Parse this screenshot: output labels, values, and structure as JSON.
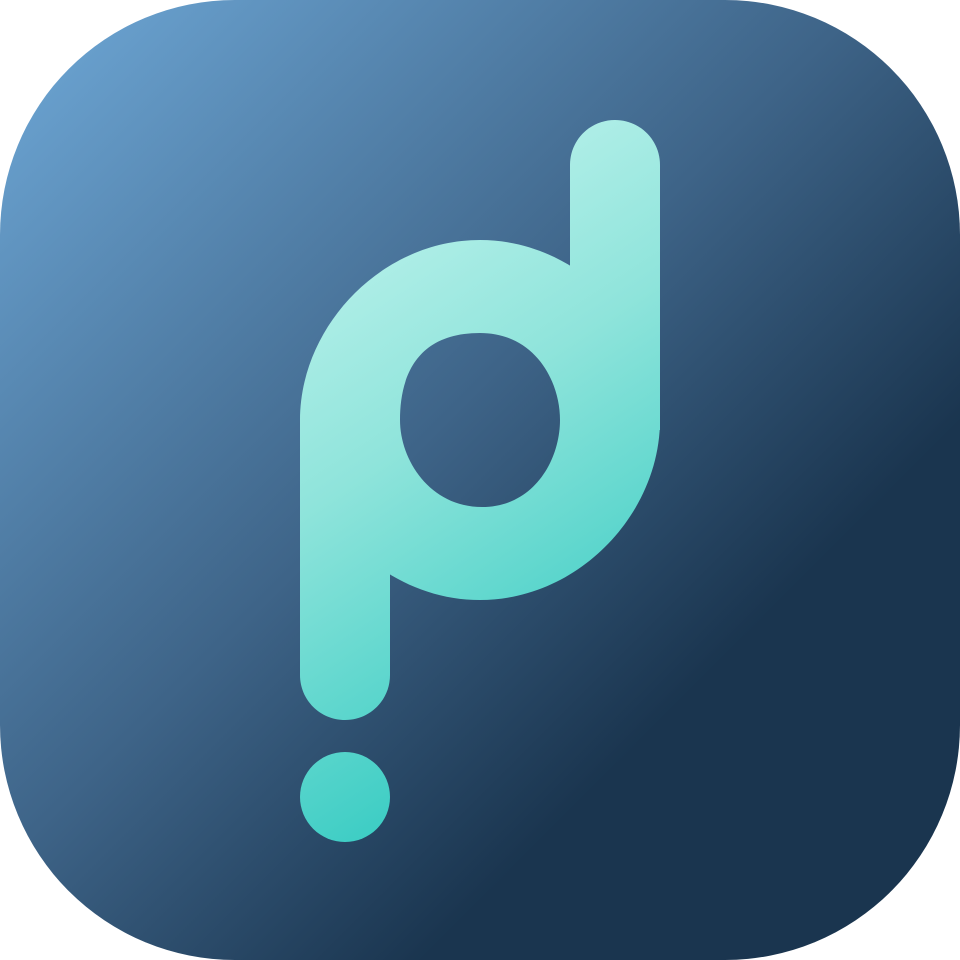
{
  "app_icon": {
    "glyph": "pd",
    "background": {
      "gradient_start": "#6fa9d8",
      "gradient_mid": "#3e6488",
      "gradient_end": "#1a354f"
    },
    "glyph_colors": {
      "light": "#c2f4ee",
      "mid": "#8fe4db",
      "dark": "#35cbc2"
    }
  }
}
